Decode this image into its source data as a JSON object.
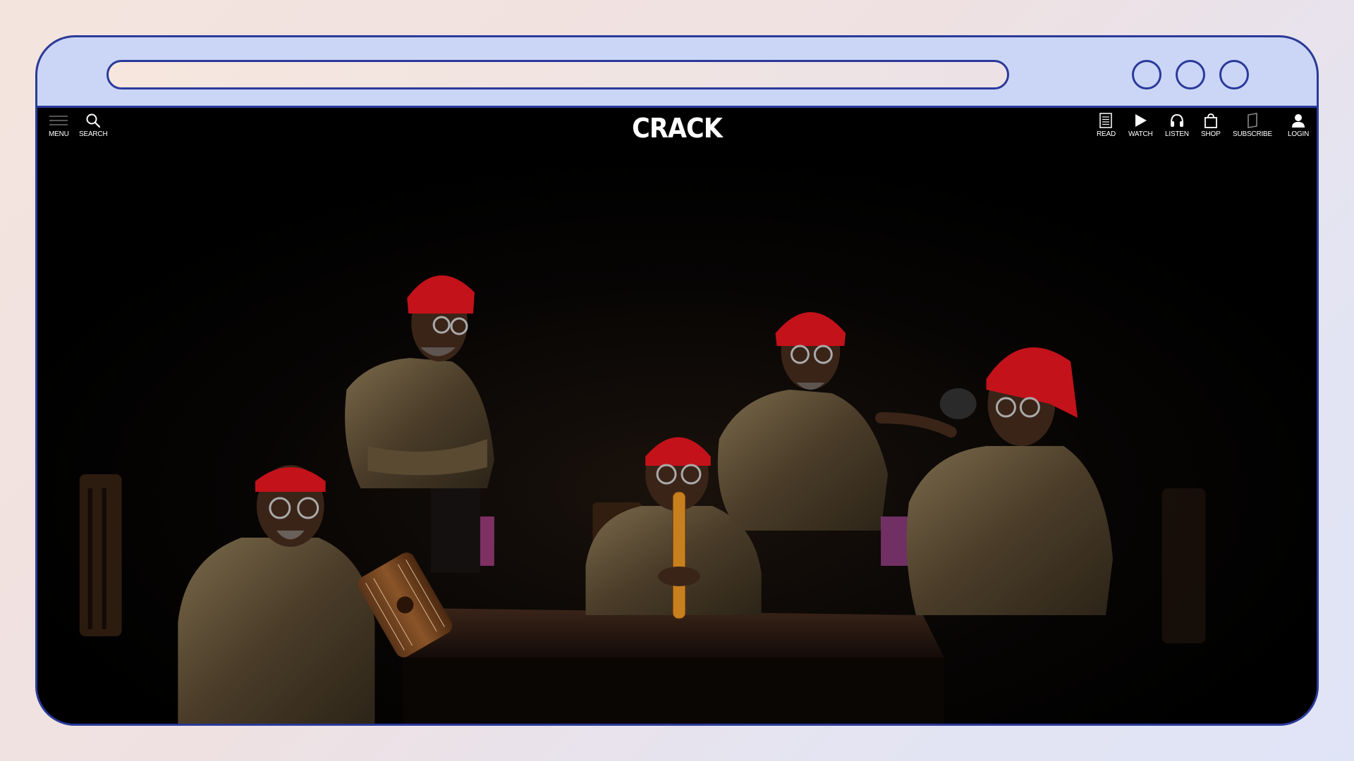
{
  "browser": {
    "window_controls": [
      "circle",
      "circle",
      "circle"
    ]
  },
  "nav": {
    "left": [
      {
        "label": "MENU",
        "icon": "menu-icon"
      },
      {
        "label": "SEARCH",
        "icon": "search-icon"
      }
    ],
    "logo": "CRACK",
    "right": [
      {
        "label": "READ",
        "icon": "document-icon"
      },
      {
        "label": "WATCH",
        "icon": "play-icon"
      },
      {
        "label": "LISTEN",
        "icon": "headphones-icon"
      },
      {
        "label": "SHOP",
        "icon": "shopping-bag-icon"
      },
      {
        "label": "SUBSCRIBE",
        "icon": "magazine-icon"
      },
      {
        "label": "LOGIN",
        "icon": "user-icon"
      }
    ]
  },
  "hero": {
    "subject": "five-musicians-photo",
    "colors": {
      "background": "#000000",
      "beanie": "#c4121a",
      "shirt": "#5a4a30",
      "table": "#2a1a12"
    }
  }
}
